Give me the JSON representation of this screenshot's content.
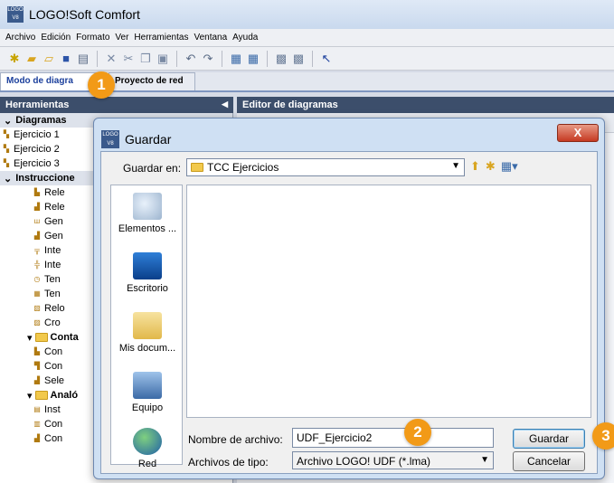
{
  "window": {
    "title": "LOGO!Soft Comfort",
    "icon": "logo-app-icon"
  },
  "menu": [
    "Archivo",
    "Edición",
    "Formato",
    "Ver",
    "Herramientas",
    "Ventana",
    "Ayuda"
  ],
  "toolbar_icons": [
    "new-icon",
    "open-icon",
    "save-icon",
    "print-icon",
    "delete-icon",
    "cut-icon",
    "copy-icon",
    "paste-icon",
    "undo-icon",
    "redo-icon",
    "download-icon",
    "upload-icon",
    "help-pointer-icon"
  ],
  "tabs": {
    "active": "Modo de diagra",
    "inactive": "Proyecto de red"
  },
  "panels": {
    "tools_title": "Herramientas",
    "editor_title": "Editor de diagramas"
  },
  "sidebar": {
    "diagrams_header": "Diagramas",
    "diagrams": [
      "Ejercicio 1",
      "Ejercicio 2",
      "Ejercicio 3"
    ],
    "instructions_header": "Instruccione",
    "instructions": [
      "Rele",
      "Rele",
      "Gen",
      "Gen",
      "Inte",
      "Inte",
      "Ten",
      "Ten",
      "Relo",
      "Cro"
    ],
    "group_conta": "Conta",
    "conta_items": [
      "Con",
      "Con",
      "Sele"
    ],
    "group_analog": "Analó",
    "analog_items": [
      "Inst",
      "Con",
      "Con"
    ]
  },
  "dialog": {
    "title": "Guardar",
    "close_label": "X",
    "lookin_label": "Guardar en:",
    "lookin_value": "TCC Ejercicios",
    "places": [
      "Elementos ...",
      "Escritorio",
      "Mis docum...",
      "Equipo",
      "Red"
    ],
    "filename_label": "Nombre de archivo:",
    "filename_value": "UDF_Ejercicio2",
    "filetype_label": "Archivos de tipo:",
    "filetype_value": "Archivo LOGO! UDF (*.lma)",
    "save_button": "Guardar",
    "cancel_button": "Cancelar"
  },
  "markers": [
    "1",
    "2",
    "3"
  ],
  "colors": {
    "marker": "#f29a17",
    "panel_header": "#3c4e6b",
    "close": "#c53a22",
    "active_tab": "#1b3f9c"
  }
}
